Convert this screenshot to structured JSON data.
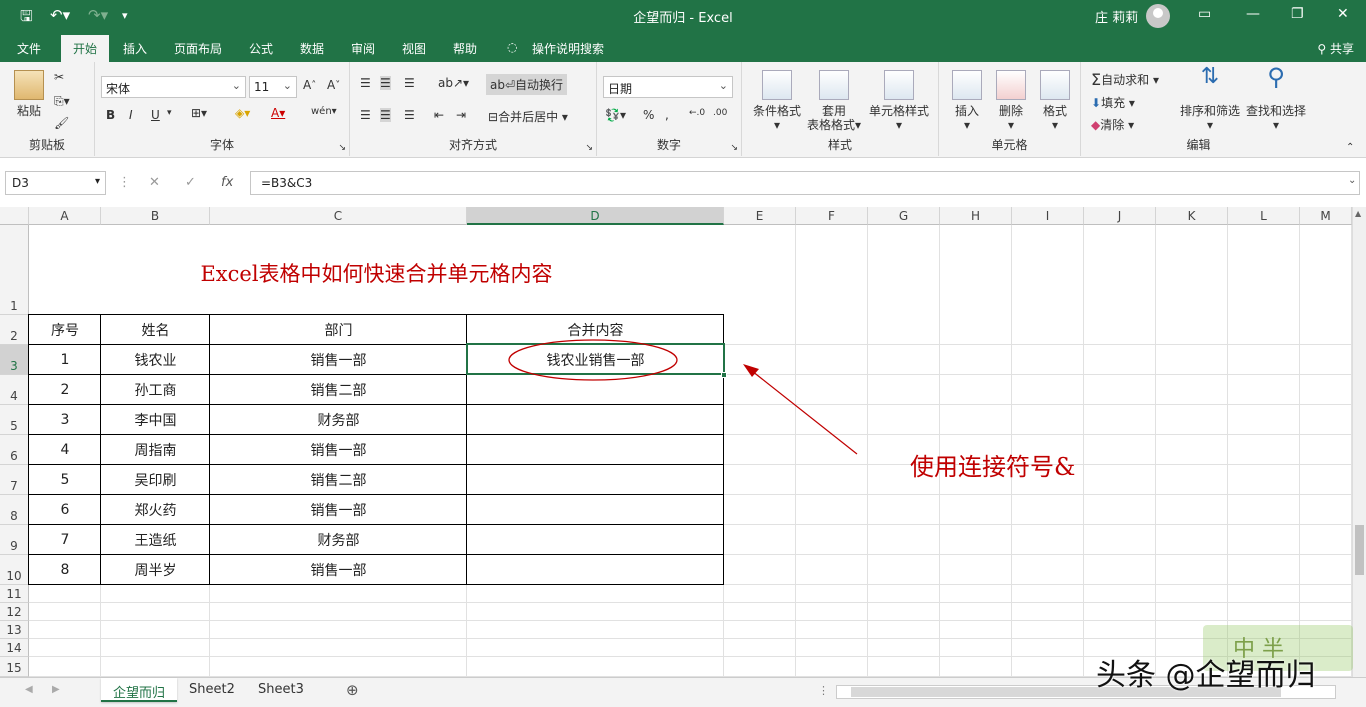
{
  "window": {
    "title": "企望而归  -  Excel",
    "user": "庄 莉莉"
  },
  "ribbon_tabs": [
    "文件",
    "开始",
    "插入",
    "页面布局",
    "公式",
    "数据",
    "审阅",
    "视图",
    "帮助"
  ],
  "active_tab": "开始",
  "tell_me": "操作说明搜索",
  "share": "共享",
  "ribbon": {
    "clipboard": {
      "label": "剪贴板",
      "paste": "粘贴"
    },
    "font": {
      "label": "字体",
      "name": "宋体",
      "size": "11",
      "bold": "B",
      "italic": "I",
      "underline": "U"
    },
    "alignment": {
      "label": "对齐方式",
      "wrap": "自动换行",
      "merge": "合并后居中"
    },
    "number": {
      "label": "数字",
      "format": "日期",
      "percent": "%",
      "comma": ","
    },
    "styles": {
      "label": "样式",
      "conditional": "条件格式",
      "table_format_1": "套用",
      "table_format_2": "表格格式",
      "cell_styles": "单元格样式"
    },
    "cells": {
      "label": "单元格",
      "insert": "插入",
      "delete": "删除",
      "format": "格式"
    },
    "editing": {
      "label": "编辑",
      "autosum": "自动求和",
      "fill": "填充",
      "clear": "清除",
      "sort": "排序和筛选",
      "find": "查找和选择"
    }
  },
  "formula_bar": {
    "name_box": "D3",
    "fx": "fx",
    "formula": "=B3&C3"
  },
  "columns": [
    "A",
    "B",
    "C",
    "D",
    "E",
    "F",
    "G",
    "H",
    "I",
    "J",
    "K",
    "L",
    "M"
  ],
  "rows": [
    "1",
    "2",
    "3",
    "4",
    "5",
    "6",
    "7",
    "8",
    "9",
    "10",
    "11",
    "12",
    "13",
    "14",
    "15"
  ],
  "sheet": {
    "title": "Excel表格中如何快速合并单元格内容",
    "headers": [
      "序号",
      "姓名",
      "部门",
      "合并内容"
    ],
    "data": [
      [
        "1",
        "钱农业",
        "销售一部",
        "钱农业销售一部"
      ],
      [
        "2",
        "孙工商",
        "销售二部",
        ""
      ],
      [
        "3",
        "李中国",
        "财务部",
        ""
      ],
      [
        "4",
        "周指南",
        "销售一部",
        ""
      ],
      [
        "5",
        "吴印刷",
        "销售二部",
        ""
      ],
      [
        "6",
        "郑火药",
        "销售一部",
        ""
      ],
      [
        "7",
        "王造纸",
        "财务部",
        ""
      ],
      [
        "8",
        "周半岁",
        "销售一部",
        ""
      ]
    ],
    "annotation": "使用连接符号&"
  },
  "sheet_tabs": [
    "企望而归",
    "Sheet2",
    "Sheet3"
  ],
  "active_sheet": "企望而归",
  "watermark": "头条 @企望而归",
  "watermark_badge": "中 半",
  "colors": {
    "excel_green": "#217346",
    "annotation_red": "#c00000"
  }
}
